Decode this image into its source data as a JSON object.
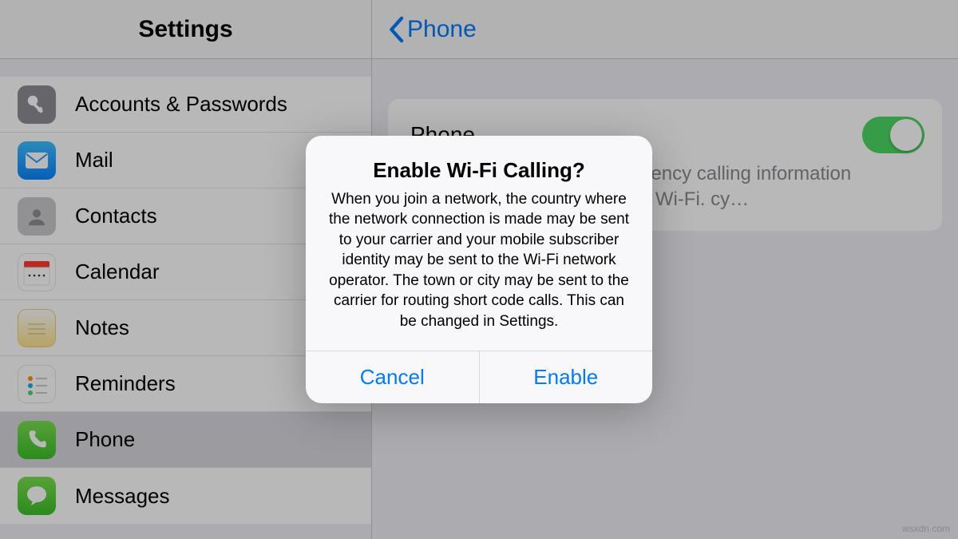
{
  "sidebar": {
    "title": "Settings",
    "items": [
      {
        "label": "Accounts & Passwords",
        "icon": "key"
      },
      {
        "label": "Mail",
        "icon": "mail"
      },
      {
        "label": "Contacts",
        "icon": "contacts"
      },
      {
        "label": "Calendar",
        "icon": "calendar"
      },
      {
        "label": "Notes",
        "icon": "notes"
      },
      {
        "label": "Reminders",
        "icon": "reminders"
      },
      {
        "label": "Phone",
        "icon": "phone",
        "selected": true
      },
      {
        "label": "Messages",
        "icon": "messages"
      }
    ]
  },
  "detail": {
    "back_label": "Phone",
    "setting_label_suffix": "Phone",
    "toggle_on": true,
    "description": "Wi-Fi with your EE account. ency calling information to of emergency calling over Wi-Fi. cy…"
  },
  "alert": {
    "title": "Enable Wi-Fi Calling?",
    "body": "When you join a network, the country where the network connection is made may be sent to your carrier and your mobile subscriber identity may be sent to the Wi-Fi network operator. The town or city may be sent to the carrier for routing short code calls. This can be changed in Settings.",
    "cancel": "Cancel",
    "confirm": "Enable"
  },
  "watermark": "wsxdn.com"
}
